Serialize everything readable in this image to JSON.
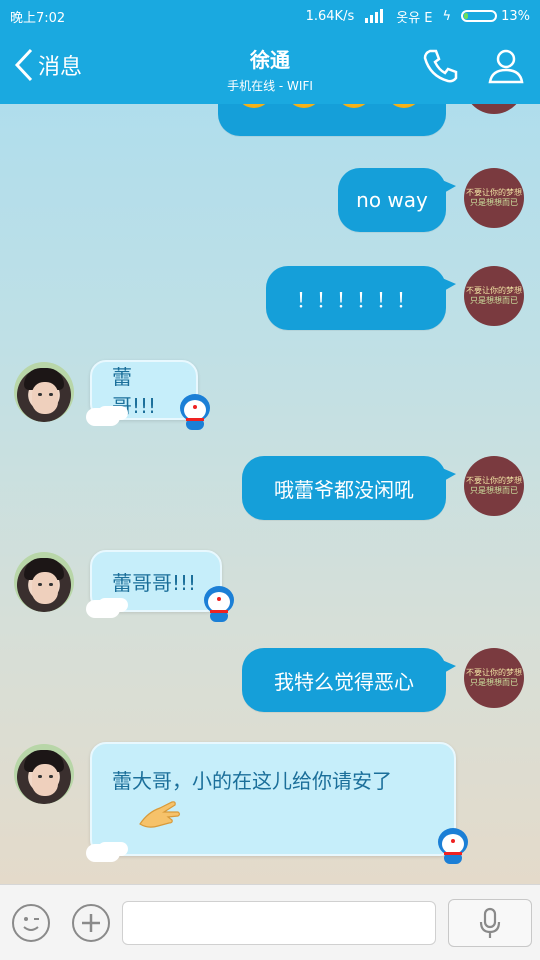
{
  "status_bar": {
    "time": "晚上7:02",
    "network_speed": "1.64K/s",
    "carrier": "옷유 E",
    "battery": "13%",
    "battery_level": 0.13
  },
  "header": {
    "back_label": "消息",
    "contact_name": "徐通",
    "contact_status": "手机在线 - WIFI"
  },
  "messages": [
    {
      "sender": "me",
      "type": "emoji",
      "text": ""
    },
    {
      "sender": "me",
      "type": "text",
      "text": "no way"
    },
    {
      "sender": "me",
      "type": "text",
      "text": "！！！！！！"
    },
    {
      "sender": "friend",
      "type": "text",
      "text": "蕾哥!!!"
    },
    {
      "sender": "me",
      "type": "text",
      "text": "哦蕾爷都没闲吼"
    },
    {
      "sender": "friend",
      "type": "text",
      "text": "蕾哥哥!!!"
    },
    {
      "sender": "me",
      "type": "text",
      "text": "我特么觉得恶心"
    },
    {
      "sender": "friend",
      "type": "text",
      "text": "蕾大哥，小的在这儿给你请安了"
    }
  ],
  "my_avatar": {
    "line1": "不要让你的梦想",
    "line2": "只是想想而已"
  },
  "input": {
    "placeholder": ""
  },
  "colors": {
    "header": "#1aa9e0",
    "outgoing_bubble": "#159fd9",
    "incoming_bubble": "#c6eefa",
    "incoming_text": "#1b6f9a"
  },
  "icons": [
    "back-chevron-icon",
    "phone-icon",
    "profile-icon",
    "emoji-icon",
    "plus-icon",
    "microphone-icon"
  ]
}
